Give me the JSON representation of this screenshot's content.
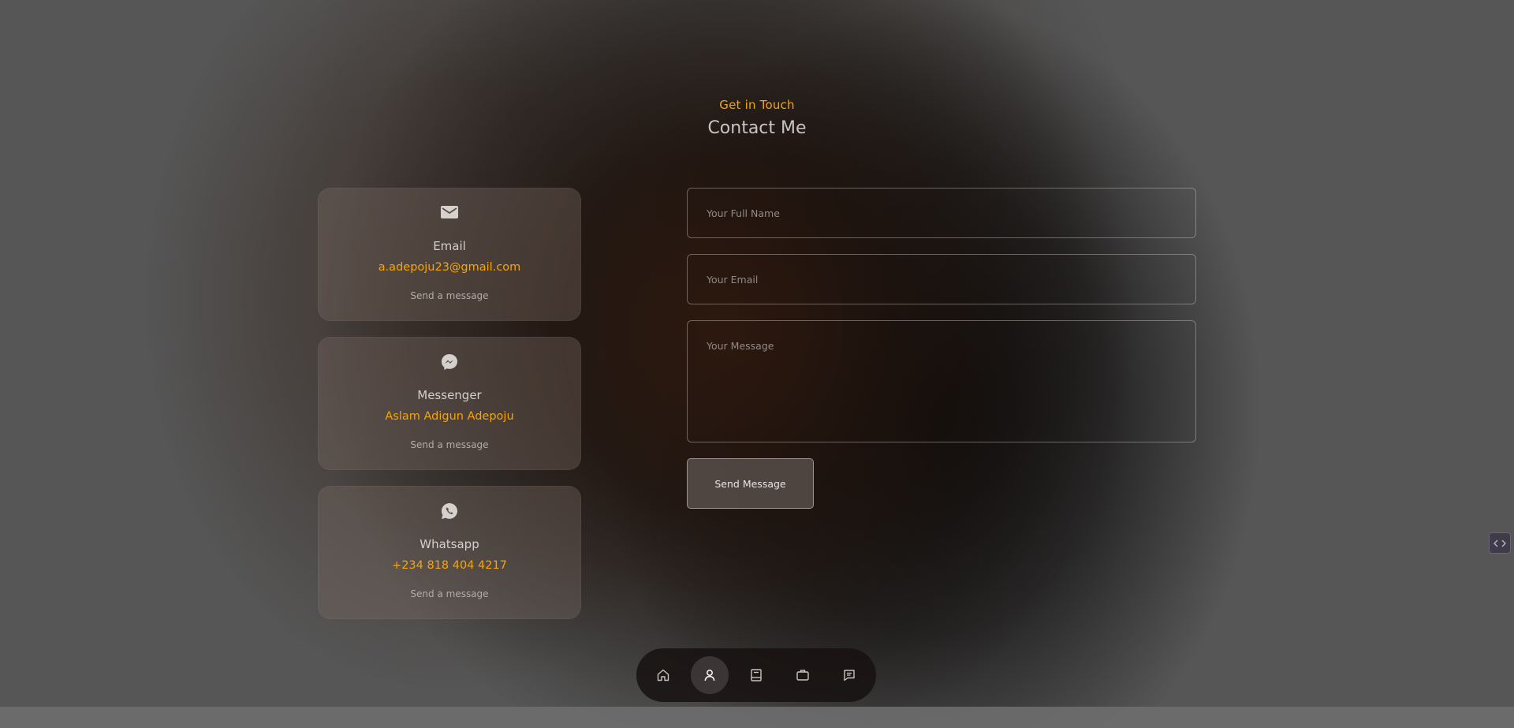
{
  "header": {
    "subtitle": "Get in Touch",
    "title": "Contact Me"
  },
  "contact_cards": [
    {
      "icon": "mail-icon",
      "label": "Email",
      "value": "a.adepoju23@gmail.com",
      "link": "Send a message"
    },
    {
      "icon": "messenger-icon",
      "label": "Messenger",
      "value": "Aslam Adigun Adepoju",
      "link": "Send a message"
    },
    {
      "icon": "whatsapp-icon",
      "label": "Whatsapp",
      "value": "+234 818 404 4217",
      "link": "Send a message"
    }
  ],
  "form": {
    "name_placeholder": "Your Full Name",
    "email_placeholder": "Your Email",
    "message_placeholder": "Your Message",
    "submit_label": "Send Message"
  },
  "nav": {
    "items": [
      {
        "icon": "home-icon",
        "active": false
      },
      {
        "icon": "user-icon",
        "active": true
      },
      {
        "icon": "book-icon",
        "active": false
      },
      {
        "icon": "briefcase-icon",
        "active": false
      },
      {
        "icon": "message-icon",
        "active": false
      }
    ]
  },
  "colors": {
    "accent": "#f5a50b",
    "text": "#d4cfcb"
  }
}
